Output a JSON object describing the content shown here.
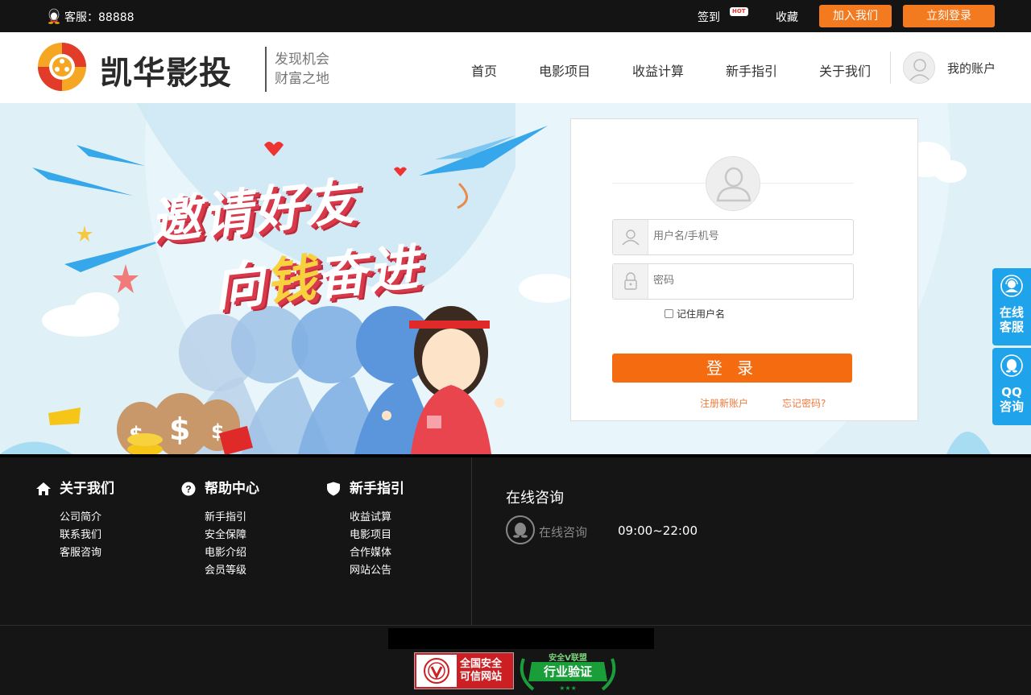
{
  "topbar": {
    "service": "客服：88888",
    "signin": "签到",
    "hot_badge": "HOT",
    "favorite": "收藏",
    "join": "加入我们",
    "login": "立刻登录"
  },
  "header": {
    "brand": "凯华影投",
    "slogan_line1": "发现机会",
    "slogan_line2": "财富之地",
    "nav": [
      "首页",
      "电影项目",
      "收益计算",
      "新手指引",
      "关于我们"
    ],
    "account": "我的账户"
  },
  "banner": {
    "title_line1": "邀请好友",
    "title_line2_a": "向",
    "title_line2_b": "钱",
    "title_line2_c": "奋进"
  },
  "login": {
    "username_placeholder": "用户名/手机号",
    "password_placeholder": "密码",
    "remember": "记住用户名",
    "submit": "登 录",
    "register": "注册新账户",
    "forgot": "忘记密码?"
  },
  "side": {
    "online_service": [
      "在线",
      "客服"
    ],
    "qq_consult": [
      "QQ",
      "咨询"
    ]
  },
  "footer": {
    "columns": [
      {
        "title": "关于我们",
        "icon": "home-icon",
        "items": [
          "公司简介",
          "联系我们",
          "客服咨询"
        ]
      },
      {
        "title": "帮助中心",
        "icon": "help-icon",
        "items": [
          "新手指引",
          "安全保障",
          "电影介绍",
          "会员等级"
        ]
      },
      {
        "title": "新手指引",
        "icon": "shield-icon",
        "items": [
          "收益试算",
          "电影项目",
          "合作媒体",
          "网站公告"
        ]
      }
    ],
    "consult_title": "在线咨询",
    "consult_label": "在线咨询",
    "consult_hours": "09:00~22:00",
    "trust_badge": [
      "全国安全",
      "可信网站"
    ],
    "verify_badge_top": "安全V联盟",
    "verify_badge": "行业验证"
  },
  "colors": {
    "accent": "#f47a20",
    "side_blue": "#1fa3ea",
    "link_orange": "#f07a3c"
  }
}
